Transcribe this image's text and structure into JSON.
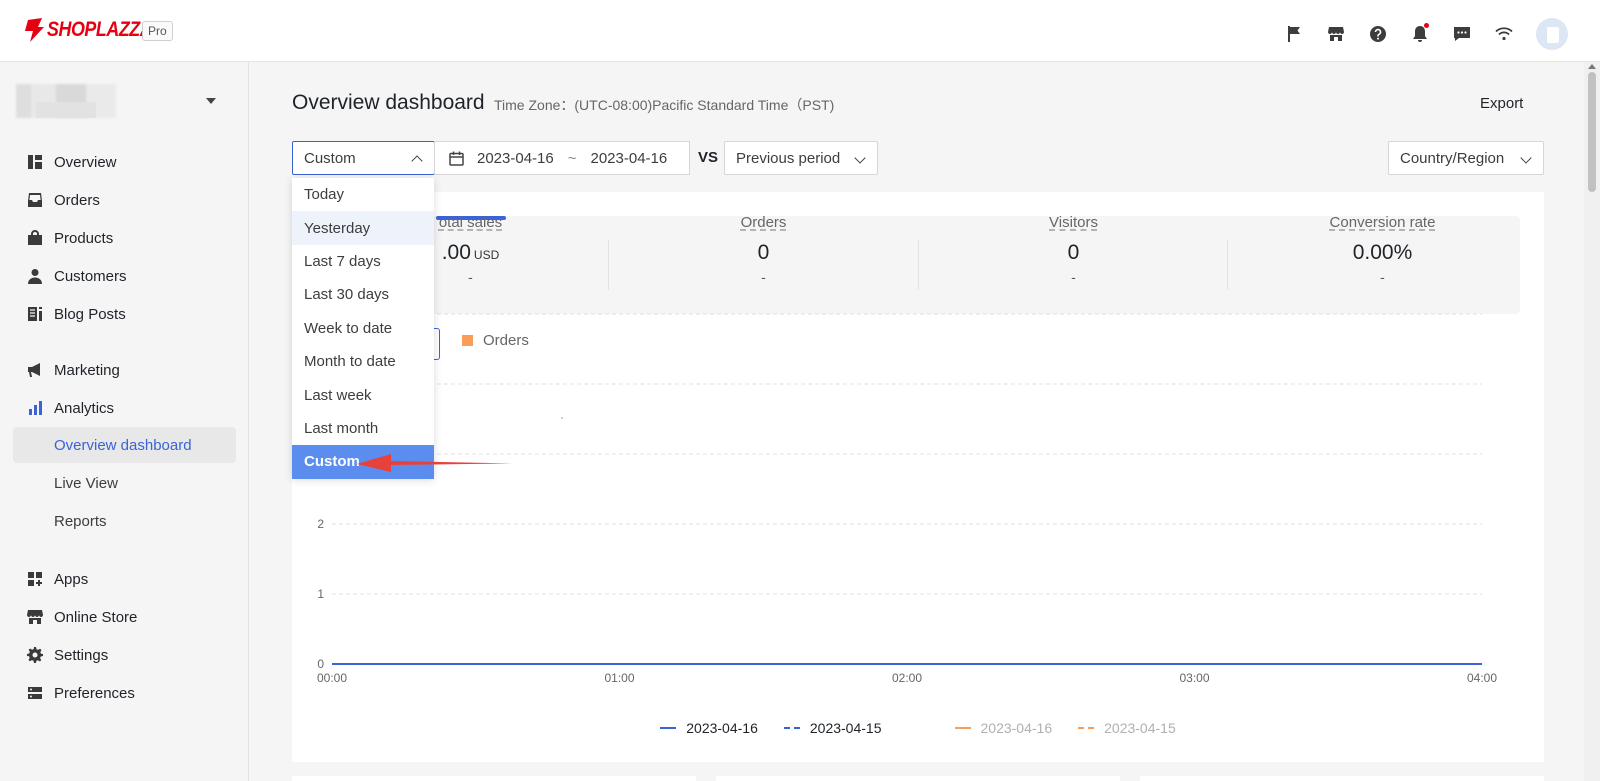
{
  "brand": {
    "logo_text": "SHOPLAZZA",
    "plan_badge": "Pro",
    "logo_color": "#e60012"
  },
  "header_icons": [
    "flag-icon",
    "store-icon",
    "help-icon",
    "bell-icon",
    "message-icon",
    "wifi-icon",
    "avatar"
  ],
  "sidebar": {
    "items": [
      {
        "label": "Overview",
        "icon": "overview-icon"
      },
      {
        "label": "Orders",
        "icon": "orders-icon"
      },
      {
        "label": "Products",
        "icon": "products-icon"
      },
      {
        "label": "Customers",
        "icon": "customers-icon"
      },
      {
        "label": "Blog Posts",
        "icon": "blog-icon"
      },
      {
        "label": "Marketing",
        "icon": "megaphone-icon"
      },
      {
        "label": "Analytics",
        "icon": "analytics-icon"
      },
      {
        "label": "Apps",
        "icon": "apps-icon"
      },
      {
        "label": "Online Store",
        "icon": "store-icon"
      },
      {
        "label": "Settings",
        "icon": "gear-icon"
      },
      {
        "label": "Preferences",
        "icon": "preferences-icon"
      }
    ],
    "analytics_sub": [
      {
        "label": "Overview dashboard",
        "active": true
      },
      {
        "label": "Live View",
        "active": false
      },
      {
        "label": "Reports",
        "active": false
      }
    ]
  },
  "page": {
    "title": "Overview dashboard",
    "timezone": "Time Zone：(UTC-08:00)Pacific Standard Time（PST)",
    "export_label": "Export"
  },
  "filters": {
    "range_select": "Custom",
    "date_start": "2023-04-16",
    "date_sep": "~",
    "date_end": "2023-04-16",
    "vs_label": "VS",
    "compare_select": "Previous period",
    "region_select": "Country/Region"
  },
  "dropdown": {
    "options": [
      "Today",
      "Yesterday",
      "Last 7 days",
      "Last 30 days",
      "Week to date",
      "Month to date",
      "Last week",
      "Last month",
      "Custom"
    ],
    "hovered": "Yesterday",
    "selected": "Custom"
  },
  "metrics": [
    {
      "label": "Total sales",
      "visible_label": "otal sales",
      "value": ".00",
      "unit": "USD",
      "diff": "-"
    },
    {
      "label": "Orders",
      "value": "0",
      "unit": "",
      "diff": "-"
    },
    {
      "label": "Visitors",
      "value": "0",
      "unit": "",
      "diff": "-"
    },
    {
      "label": "Conversion rate",
      "value": "0.00%",
      "unit": "",
      "diff": "-"
    }
  ],
  "series_toggle": {
    "label": "Orders",
    "color": "#f89e59"
  },
  "chart_data": {
    "type": "line",
    "x": [
      "00:00",
      "01:00",
      "02:00",
      "03:00",
      "04:00"
    ],
    "y_ticks": [
      "0",
      "1",
      "2"
    ],
    "ylim": [
      0,
      5
    ],
    "grid": true,
    "series": [
      {
        "name": "2023-04-16",
        "values": [
          0,
          0,
          0,
          0,
          0
        ],
        "color": "#3a63d8",
        "style": "solid"
      },
      {
        "name": "2023-04-15",
        "values": [
          0,
          0,
          0,
          0,
          0
        ],
        "color": "#3a63d8",
        "style": "dashed"
      },
      {
        "name": "2023-04-16",
        "values": [
          0,
          0,
          0,
          0,
          0
        ],
        "color": "#f89e59",
        "style": "solid",
        "dimmed": true
      },
      {
        "name": "2023-04-15",
        "values": [
          0,
          0,
          0,
          0,
          0
        ],
        "color": "#f89e59",
        "style": "dashed",
        "dimmed": true
      }
    ]
  },
  "colors": {
    "accent": "#3a63d8",
    "orange": "#f89e59",
    "arrow": "#e8413c"
  }
}
